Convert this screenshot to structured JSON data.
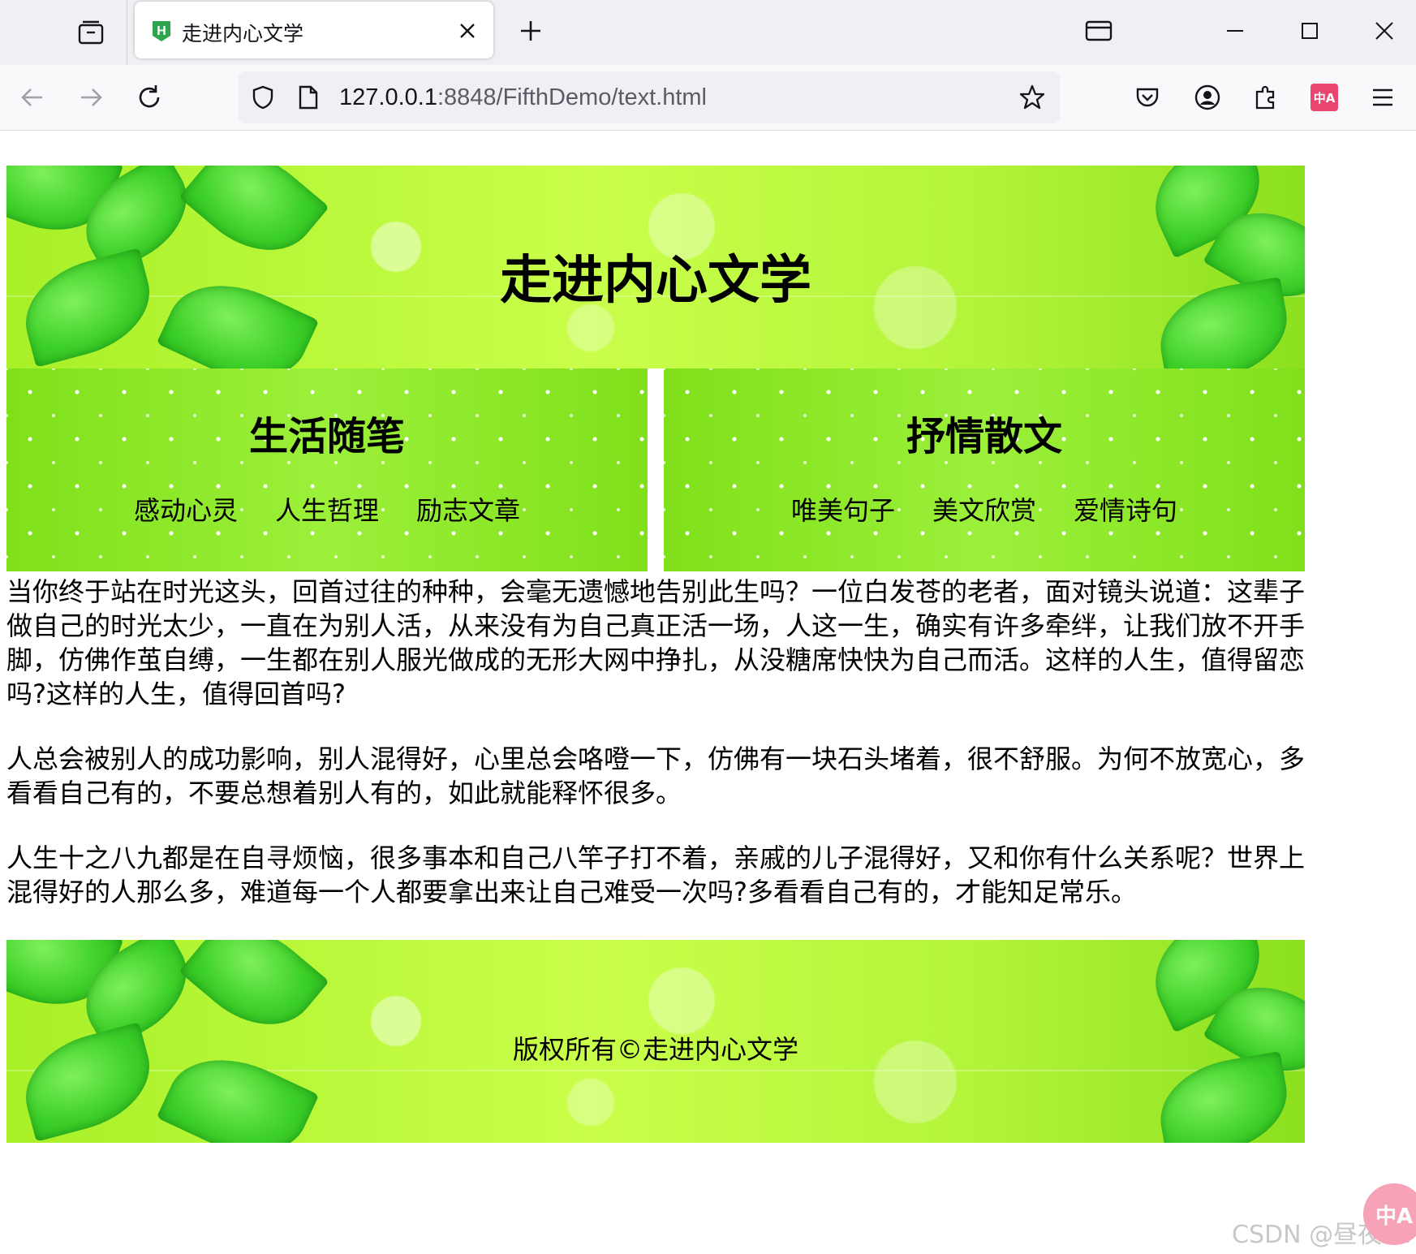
{
  "browser": {
    "tab_title": "走进内心文学",
    "tab_favicon_letter": "H",
    "url_host": "127.0.0.1",
    "url_rest": ":8848/FifthDemo/text.html",
    "extension_label": "中A"
  },
  "header": {
    "title": "走进内心文学"
  },
  "sections": [
    {
      "title": "生活随笔",
      "links": [
        "感动心灵",
        "人生哲理",
        "励志文章"
      ]
    },
    {
      "title": "抒情散文",
      "links": [
        "唯美句子",
        "美文欣赏",
        "爱情诗句"
      ]
    }
  ],
  "article": {
    "paragraphs": [
      "当你终于站在时光这头，回首过往的种种，会毫无遗憾地告别此生吗？一位白发苍的老者，面对镜头说道：这辈子做自己的时光太少，一直在为别人活，从来没有为自己真正活一场，人这一生，确实有许多牵绊，让我们放不开手脚，仿佛作茧自缚，一生都在别人服光做成的无形大网中挣扎，从没糖席快快为自己而活。这样的人生，值得留恋吗?这样的人生，值得回首吗?",
      "人总会被别人的成功影响，别人混得好，心里总会咯噔一下，仿佛有一块石头堵着，很不舒服。为何不放宽心，多看看自己有的，不要总想着别人有的，如此就能释怀很多。",
      "人生十之八九都是在自寻烦恼，很多事本和自己八竿子打不着，亲戚的儿子混得好，又和你有什么关系呢？世界上混得好的人那么多，难道每一个人都要拿出来让自己难受一次吗?多看看自己有的，才能知足常乐。"
    ]
  },
  "footer": {
    "copyright": "版权所有©走进内心文学"
  },
  "overlay": {
    "watermark": "CSDN @昼夜dz",
    "bubble_label": "中A"
  },
  "colors": {
    "banner_green": "#b3f43a",
    "column_green": "#8ce82a",
    "favicon_green": "#2ea44f",
    "extension_pink": "#e8456f"
  }
}
